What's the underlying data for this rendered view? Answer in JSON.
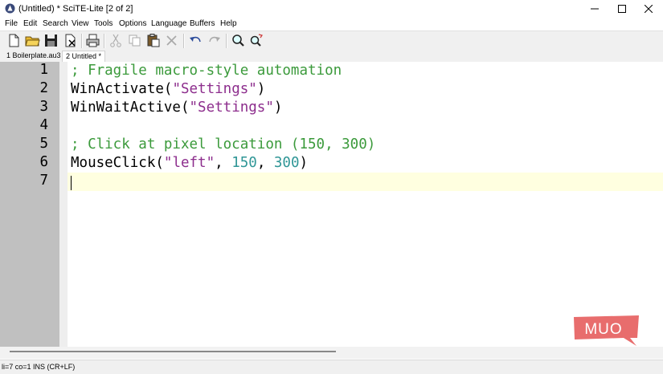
{
  "window": {
    "title": "(Untitled) * SciTE-Lite [2 of 2]",
    "icon": "scite-app-icon"
  },
  "menu": [
    "File",
    "Edit",
    "Search",
    "View",
    "Tools",
    "Options",
    "Language",
    "Buffers",
    "Help"
  ],
  "toolbar": {
    "buttons": [
      "new-file-icon",
      "open-folder-icon",
      "save-icon",
      "close-file-icon",
      "print-icon",
      "cut-icon",
      "copy-icon",
      "paste-icon",
      "delete-icon",
      "undo-icon",
      "redo-icon",
      "find-icon",
      "replace-icon"
    ]
  },
  "tabs": [
    {
      "label": "1 Boilerplate.au3",
      "active": false
    },
    {
      "label": "2 Untitled *",
      "active": true
    }
  ],
  "editor": {
    "line_numbers": [
      "1",
      "2",
      "3",
      "4",
      "5",
      "6",
      "7"
    ],
    "lines": [
      [
        {
          "t": "; Fragile macro-style automation",
          "c": "comment"
        }
      ],
      [
        {
          "t": "WinActivate(",
          "c": "plain"
        },
        {
          "t": "\"Settings\"",
          "c": "string"
        },
        {
          "t": ")",
          "c": "plain"
        }
      ],
      [
        {
          "t": "WinWaitActive(",
          "c": "plain"
        },
        {
          "t": "\"Settings\"",
          "c": "string"
        },
        {
          "t": ")",
          "c": "plain"
        }
      ],
      [],
      [
        {
          "t": "; Click at pixel location (150, 300)",
          "c": "comment"
        }
      ],
      [
        {
          "t": "MouseClick(",
          "c": "plain"
        },
        {
          "t": "\"left\"",
          "c": "string"
        },
        {
          "t": ", ",
          "c": "plain"
        },
        {
          "t": "150",
          "c": "num"
        },
        {
          "t": ", ",
          "c": "plain"
        },
        {
          "t": "300",
          "c": "num"
        },
        {
          "t": ")",
          "c": "plain"
        }
      ],
      []
    ],
    "caret_line": 7
  },
  "status": {
    "text": "li=7 co=1 INS (CR+LF)"
  },
  "watermark": {
    "text": "MUO"
  },
  "colors": {
    "comment": "#3b9a3b",
    "string": "#8d2e8d",
    "number": "#2f9696",
    "caret_line_bg": "#ffffe0",
    "gutter": "#c0c0c0",
    "watermark_bg": "#e86d6d"
  }
}
